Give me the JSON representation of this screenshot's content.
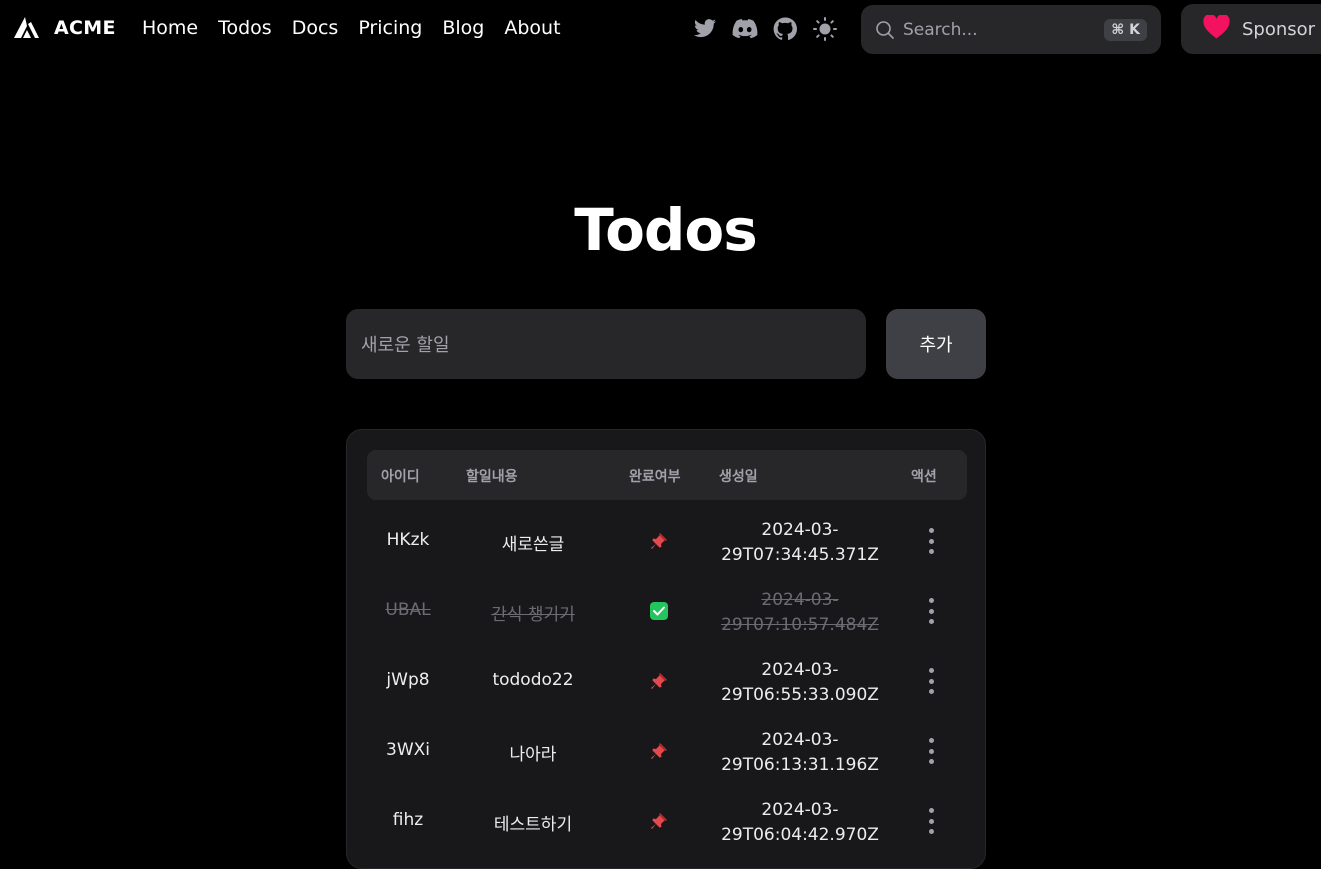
{
  "nav": {
    "brand": "ACME",
    "links": [
      "Home",
      "Todos",
      "Docs",
      "Pricing",
      "Blog",
      "About"
    ],
    "social_icons": [
      "twitter-icon",
      "discord-icon",
      "github-icon",
      "theme-toggle-icon"
    ],
    "search": {
      "placeholder": "Search...",
      "shortcut": "⌘ K"
    },
    "sponsor": {
      "label": "Sponsor",
      "heart_color": "#F31260"
    }
  },
  "page": {
    "title": "Todos",
    "new_todo_placeholder": "새로운 할일",
    "add_button": "추가"
  },
  "table": {
    "columns": [
      "아이디",
      "할일내용",
      "완료여부",
      "생성일",
      "액션"
    ],
    "rows": [
      {
        "id": "HKzk",
        "content": "새로쓴글",
        "done": false,
        "status_icon": "pin-icon",
        "date_line1": "2024-03-",
        "date_line2": "29T07:34:45.371Z"
      },
      {
        "id": "UBAL",
        "content": "간식 챙기기",
        "done": true,
        "status_icon": "check-icon",
        "date_line1": "2024-03-",
        "date_line2": "29T07:10:57.484Z"
      },
      {
        "id": "jWp8",
        "content": "tododo22",
        "done": false,
        "status_icon": "pin-icon",
        "date_line1": "2024-03-",
        "date_line2": "29T06:55:33.090Z"
      },
      {
        "id": "3WXi",
        "content": "나아라",
        "done": false,
        "status_icon": "pin-icon",
        "date_line1": "2024-03-",
        "date_line2": "29T06:13:31.196Z"
      },
      {
        "id": "fihz",
        "content": "테스트하기",
        "done": false,
        "status_icon": "pin-icon",
        "date_line1": "2024-03-",
        "date_line2": "29T06:04:42.970Z"
      }
    ]
  },
  "colors": {
    "background": "#000000",
    "surface": "#18181B",
    "input_bg": "#27272A",
    "button_bg": "#3F3F46",
    "done_check": "#22C55E",
    "pin": "#E5484D"
  }
}
